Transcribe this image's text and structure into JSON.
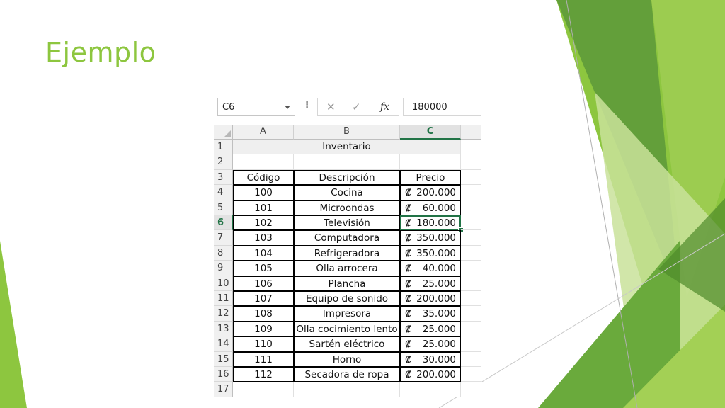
{
  "slide": {
    "title": "Ejemplo",
    "colors": {
      "title": "#8dc63f",
      "accent_dark": "#4e8a2a",
      "accent_light": "#a8d05a"
    }
  },
  "excel": {
    "namebox": "C6",
    "formula_icons": {
      "cancel": "cancel-icon",
      "enter": "check-icon",
      "function": "fx-icon"
    },
    "formula_value": "180000",
    "column_headers": [
      "A",
      "B",
      "C"
    ],
    "active_column": "C",
    "row_numbers": [
      "1",
      "2",
      "3",
      "4",
      "5",
      "6",
      "7",
      "8",
      "9",
      "10",
      "11",
      "12",
      "13",
      "14",
      "15",
      "16",
      "17"
    ],
    "active_row": "6",
    "sheet_title": "Inventario",
    "table_headers": [
      "Código",
      "Descripción",
      "Precio"
    ],
    "currency_symbol": "₡",
    "rows": [
      {
        "codigo": "100",
        "descripcion": "Cocina",
        "precio": "200.000"
      },
      {
        "codigo": "101",
        "descripcion": "Microondas",
        "precio": "60.000"
      },
      {
        "codigo": "102",
        "descripcion": "Televisión",
        "precio": "180.000"
      },
      {
        "codigo": "103",
        "descripcion": "Computadora",
        "precio": "350.000"
      },
      {
        "codigo": "104",
        "descripcion": "Refrigeradora",
        "precio": "350.000"
      },
      {
        "codigo": "105",
        "descripcion": "Olla arrocera",
        "precio": "40.000"
      },
      {
        "codigo": "106",
        "descripcion": "Plancha",
        "precio": "25.000"
      },
      {
        "codigo": "107",
        "descripcion": "Equipo de sonido",
        "precio": "200.000"
      },
      {
        "codigo": "108",
        "descripcion": "Impresora",
        "precio": "35.000"
      },
      {
        "codigo": "109",
        "descripcion": "Olla cocimiento lento",
        "precio": "25.000"
      },
      {
        "codigo": "110",
        "descripcion": "Sartén eléctrico",
        "precio": "25.000"
      },
      {
        "codigo": "111",
        "descripcion": "Horno",
        "precio": "30.000"
      },
      {
        "codigo": "112",
        "descripcion": "Secadora de ropa",
        "precio": "200.000"
      }
    ]
  }
}
